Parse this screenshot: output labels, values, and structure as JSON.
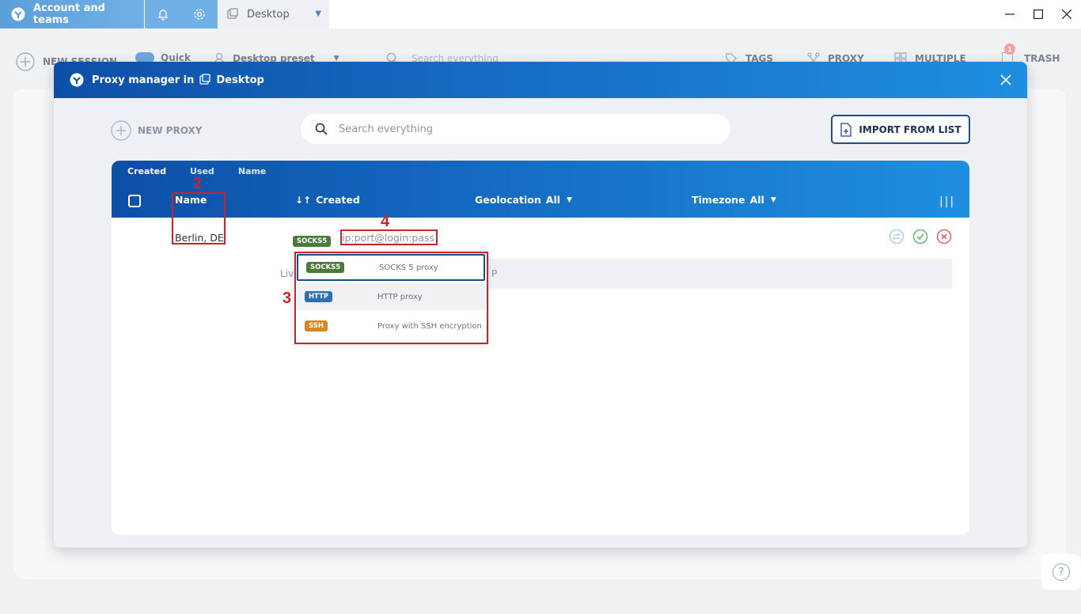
{
  "titlebar": {
    "account_tab": "Account and teams",
    "workspace_tab": "Desktop"
  },
  "bg_toolbar": {
    "new_session": "NEW SESSION",
    "quick": "Quick",
    "preset": "Desktop preset",
    "search_placeholder": "Search everything",
    "tags": "TAGS",
    "proxy": "PROXY",
    "multiple": "MULTIPLE",
    "trash": "TRASH",
    "trash_count": "1"
  },
  "modal": {
    "title": "Proxy manager in",
    "workspace": "Desktop",
    "new_proxy": "NEW PROXY",
    "search_placeholder": "Search everything",
    "import_button": "IMPORT FROM LIST",
    "sort_tabs": [
      "Created",
      "Used",
      "Name"
    ],
    "columns": {
      "name": "Name",
      "created": "Created",
      "geolocation": "Geolocation",
      "geolocation_filter": "All",
      "timezone": "Timezone",
      "timezone_filter": "All"
    },
    "row": {
      "name": "Berlin, DE",
      "type": "SOCKS5",
      "connection_placeholder": "ip:port@login:pass",
      "live_label": "Liv",
      "live_value": "P"
    },
    "dropdown": [
      {
        "badge": "SOCKS5",
        "desc": "SOCKS 5 proxy"
      },
      {
        "badge": "HTTP",
        "desc": "HTTP proxy"
      },
      {
        "badge": "SSH",
        "desc": "Proxy with SSH encryption"
      }
    ]
  },
  "annotations": [
    "2",
    "3",
    "4"
  ],
  "colors": {
    "header_dark": "#0d4fa8",
    "header_light": "#1f8fe0",
    "annotation": "#d0202a"
  }
}
